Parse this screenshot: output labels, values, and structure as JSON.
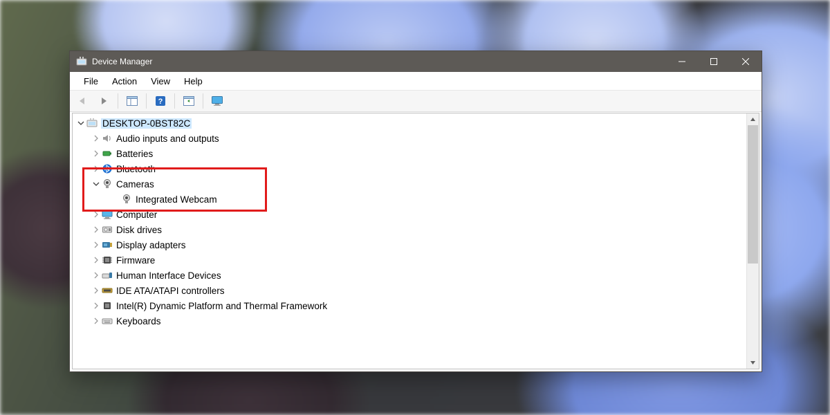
{
  "window": {
    "title": "Device Manager"
  },
  "menu": {
    "file": "File",
    "action": "Action",
    "view": "View",
    "help": "Help"
  },
  "tree": {
    "root": "DESKTOP-0BST82C",
    "items": [
      {
        "label": "Audio inputs and outputs"
      },
      {
        "label": "Batteries"
      },
      {
        "label": "Bluetooth"
      },
      {
        "label": "Cameras"
      },
      {
        "label": "Computer"
      },
      {
        "label": "Disk drives"
      },
      {
        "label": "Display adapters"
      },
      {
        "label": "Firmware"
      },
      {
        "label": "Human Interface Devices"
      },
      {
        "label": "IDE ATA/ATAPI controllers"
      },
      {
        "label": "Intel(R) Dynamic Platform and Thermal Framework"
      },
      {
        "label": "Keyboards"
      }
    ],
    "cameras_child": "Integrated Webcam"
  }
}
